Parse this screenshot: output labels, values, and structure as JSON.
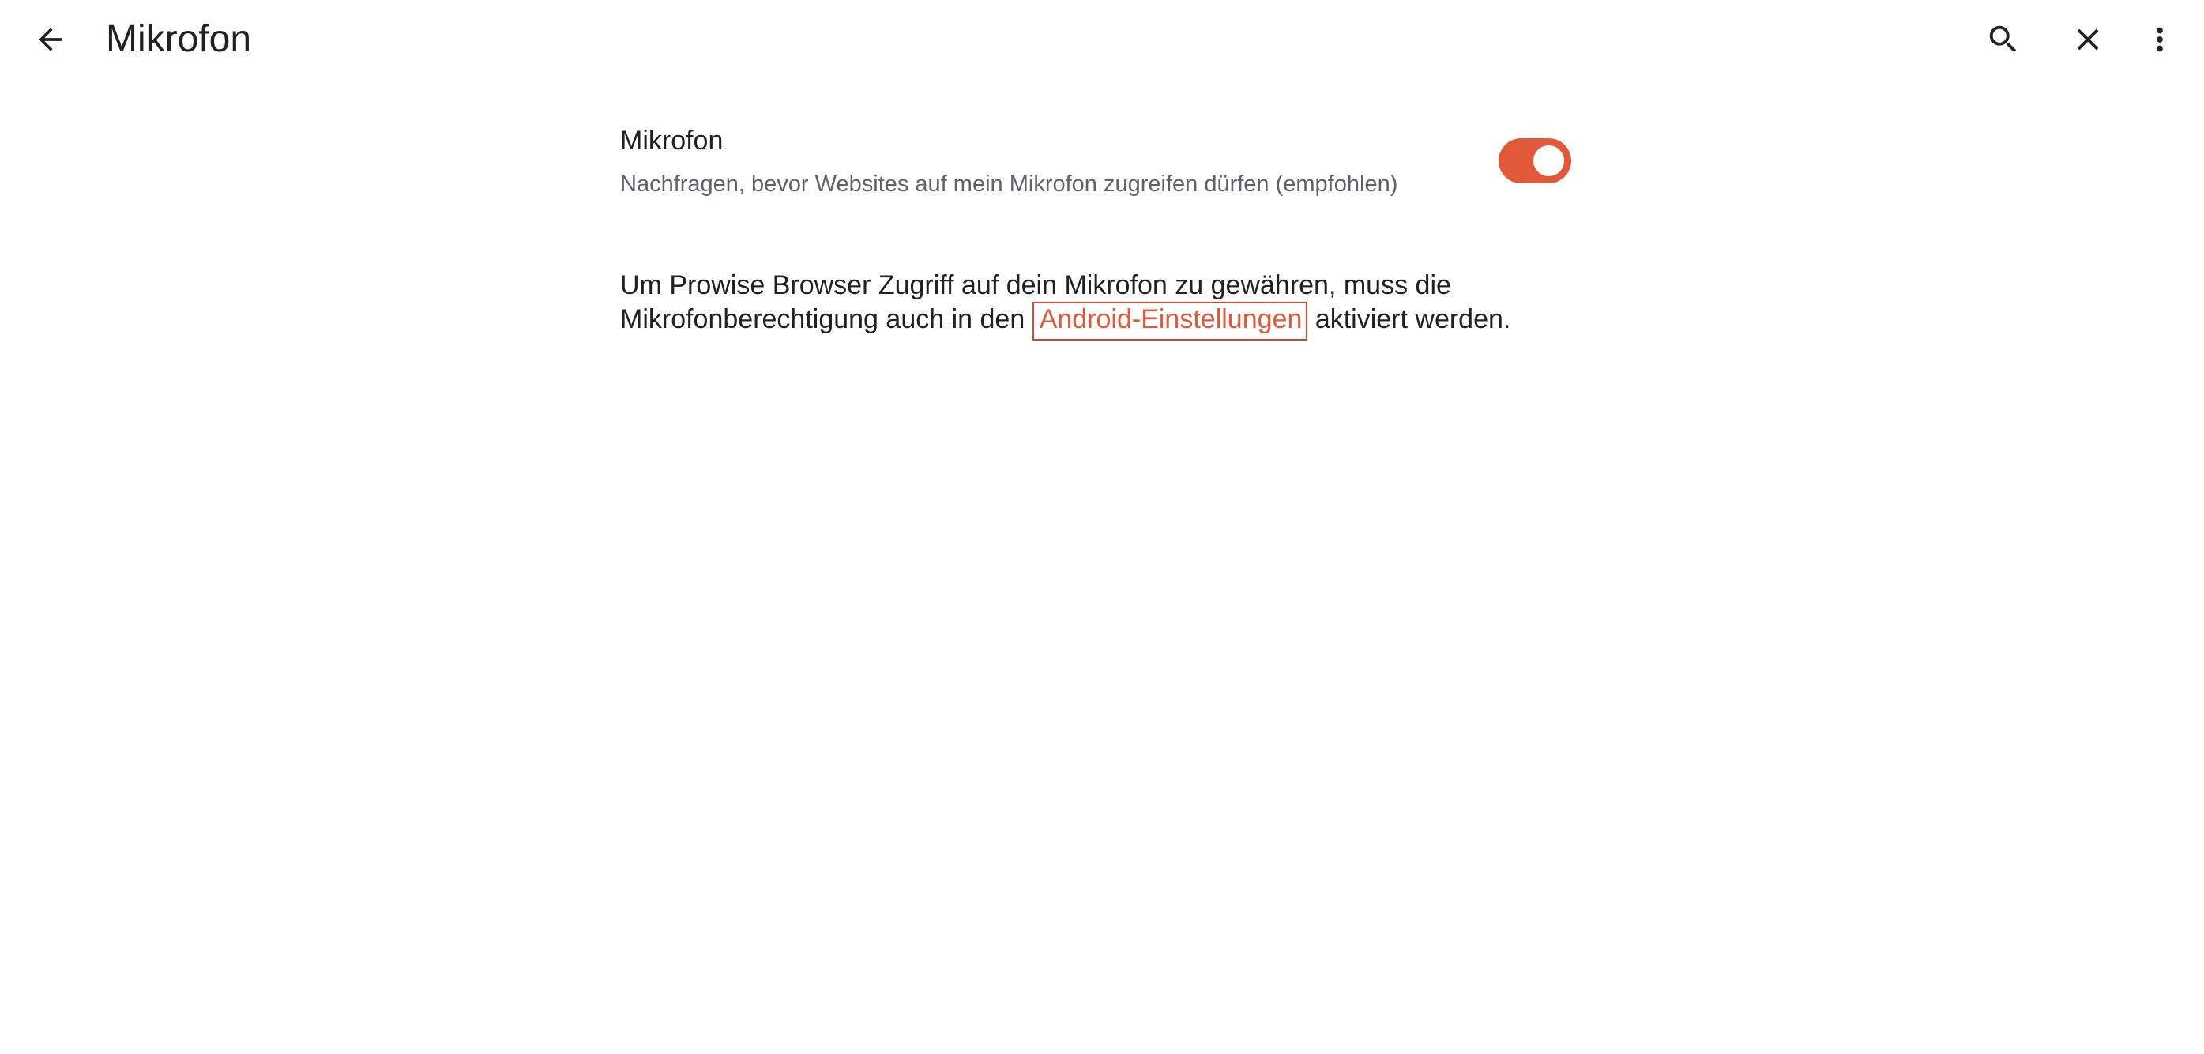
{
  "toolbar": {
    "title": "Mikrofon",
    "icons": {
      "back": "arrow-back-icon",
      "search": "search-icon",
      "close": "close-icon",
      "more": "more-vert-icon"
    }
  },
  "setting": {
    "title": "Mikrofon",
    "summary": "Nachfragen, bevor Websites auf mein Mikrofon zugreifen dürfen (empfohlen)",
    "enabled": true,
    "accent_color": "#e2593a"
  },
  "explanation": {
    "line1": "Um Prowise Browser Zugriff auf dein Mikrofon zu gewähren, muss die",
    "line2_before": "Mikrofonberechtigung auch in den",
    "link_text": "Android-Einstellungen",
    "line2_after": "aktiviert werden."
  }
}
